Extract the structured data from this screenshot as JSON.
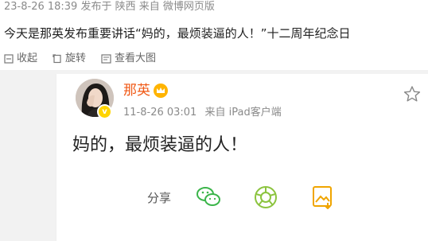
{
  "post": {
    "meta": "23-8-26 18:39 发布于 陕西 来自 微博网页版",
    "text": "今天是那英发布重要讲话“妈的，最烦装逼的人！”十二周年纪念日"
  },
  "toolbar": {
    "collect": "收起",
    "rotate": "旋转",
    "view_large": "查看大图"
  },
  "embedded_post": {
    "name": "那英",
    "timestamp": "11-8-26 03:01",
    "source": "来自 iPad客户端",
    "content": "妈的，最烦装逼的人！",
    "share_label": "分享"
  },
  "colors": {
    "name": "#f05a17",
    "wechat": "#3bb54a",
    "moments": "#8cc43f",
    "album": "#f0a500"
  }
}
